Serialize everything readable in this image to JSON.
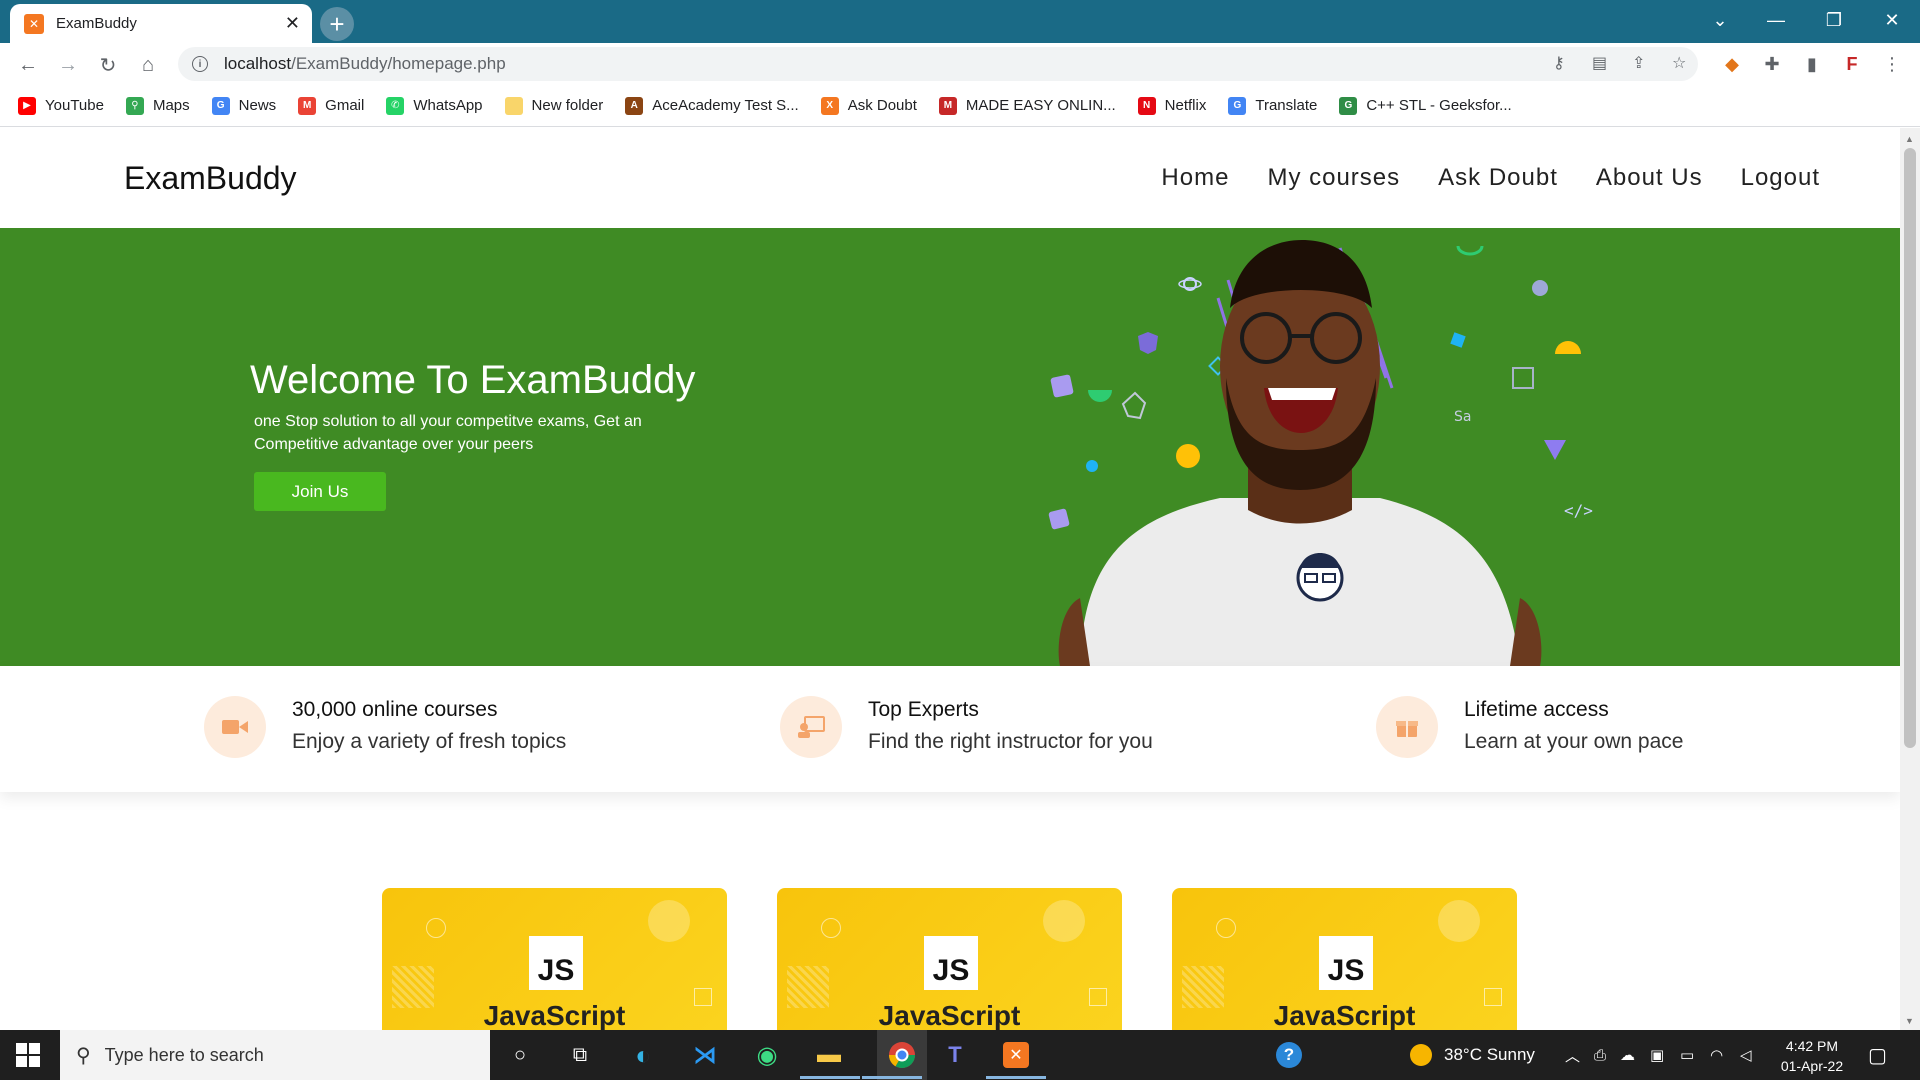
{
  "browser": {
    "tab_title": "ExamBuddy",
    "tab_favicon": "xampp-icon",
    "url_host": "localhost",
    "url_path": "/ExamBuddy/homepage.php",
    "bookmarks": [
      {
        "label": "YouTube",
        "icon": "youtube-icon",
        "color": "#ff0000",
        "glyph": "▶"
      },
      {
        "label": "Maps",
        "icon": "maps-icon",
        "color": "#34a853",
        "glyph": "⚲"
      },
      {
        "label": "News",
        "icon": "news-icon",
        "color": "#4285f4",
        "glyph": "G"
      },
      {
        "label": "Gmail",
        "icon": "gmail-icon",
        "color": "#ea4335",
        "glyph": "M"
      },
      {
        "label": "WhatsApp",
        "icon": "whatsapp-icon",
        "color": "#25d366",
        "glyph": "✆"
      },
      {
        "label": "New folder",
        "icon": "folder-icon",
        "color": "#f9d56a",
        "glyph": ""
      },
      {
        "label": "AceAcademy Test S...",
        "icon": "aceacademy-icon",
        "color": "#8b4513",
        "glyph": "A"
      },
      {
        "label": "Ask Doubt",
        "icon": "xampp-icon",
        "color": "#f47721",
        "glyph": "X"
      },
      {
        "label": "MADE EASY ONLIN...",
        "icon": "madeeasy-icon",
        "color": "#c62828",
        "glyph": "M"
      },
      {
        "label": "Netflix",
        "icon": "netflix-icon",
        "color": "#e50914",
        "glyph": "N"
      },
      {
        "label": "Translate",
        "icon": "translate-icon",
        "color": "#4285f4",
        "glyph": "G"
      },
      {
        "label": "C++ STL - Geeksfor...",
        "icon": "geeksforgeeks-icon",
        "color": "#2f8d46",
        "glyph": "G"
      }
    ]
  },
  "site": {
    "brand": "ExamBuddy",
    "nav": [
      "Home",
      "My courses",
      "Ask Doubt",
      "About Us",
      "Logout"
    ],
    "hero": {
      "title": "Welcome To ExamBuddy",
      "subtitle": "one Stop solution to all your competitve exams, Get an Competitive advantage over your peers",
      "cta": "Join Us"
    },
    "features": [
      {
        "title": "30,000 online courses",
        "subtitle": "Enjoy a variety of fresh topics",
        "icon": "video-camera-icon"
      },
      {
        "title": "Top Experts",
        "subtitle": "Find the right instructor for you",
        "icon": "instructor-icon"
      },
      {
        "title": "Lifetime access",
        "subtitle": "Learn at your own pace",
        "icon": "gift-box-icon"
      }
    ],
    "courses": [
      {
        "logo": "JS",
        "title": "JavaScript"
      },
      {
        "logo": "JS",
        "title": "JavaScript"
      },
      {
        "logo": "JS",
        "title": "JavaScript"
      }
    ],
    "colors": {
      "hero_bg": "#3f8b24",
      "cta_bg": "#49b81f",
      "card_bg": "#f8c40c",
      "feature_icon_bg": "#fdebdc"
    }
  },
  "taskbar": {
    "search_placeholder": "Type here to search",
    "weather": "38°C  Sunny",
    "time": "4:42 PM",
    "date": "01-Apr-22"
  }
}
